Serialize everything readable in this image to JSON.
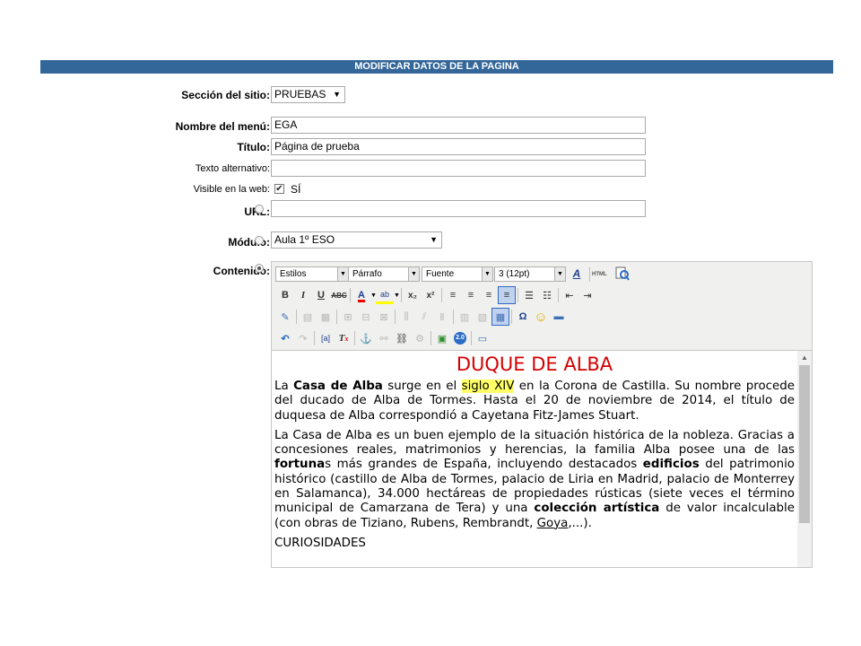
{
  "banner": {
    "title": "MODIFICAR DATOS DE LA PAGINA",
    "color": "#336699"
  },
  "form": {
    "seccion": {
      "label": "Sección del sitio:",
      "value": "PRUEBAS"
    },
    "nombre_menu": {
      "label": "Nombre del menú:",
      "value": "EGA"
    },
    "titulo": {
      "label": "Título:",
      "value": "Página de prueba"
    },
    "texto_alternativo": {
      "label": "Texto alternativo:",
      "value": ""
    },
    "visible": {
      "label": "Visible en la web:",
      "checked": true,
      "text": "SÍ"
    },
    "url": {
      "label": "URL:",
      "selected": false,
      "value": ""
    },
    "modulo": {
      "label": "Módulo:",
      "selected": false,
      "value": "Aula 1º ESO"
    },
    "contenido": {
      "label": "Contenido:",
      "selected": true
    }
  },
  "editor": {
    "toolbar": {
      "style_select": "Estilos",
      "format_select": "Párrafo",
      "font_select": "Fuente",
      "size_select": "3 (12pt)",
      "html_button": "HTML"
    },
    "content": {
      "heading": "DUQUE DE ALBA",
      "p1": {
        "t1": "La ",
        "b1": "Casa de Alba",
        "t2": " surge en el ",
        "hl": "siglo XIV",
        "t3": " en la Corona de Castilla. Su nombre procede del ducado de Alba de Tormes. Hasta el 20 de noviembre de 2014, el título de duquesa de Alba correspondió a Cayetana Fitz-James Stuart."
      },
      "p2": {
        "t1": "La Casa de Alba es un buen ejemplo de la situación histórica de la nobleza. Gracias a concesiones reales, matrimonios y herencias, la familia Alba posee una de las ",
        "b1": "fortuna",
        "t2": "s más grandes de España, incluyendo destacados ",
        "b2": "edificios",
        "t3": " del patrimonio histórico (castillo de Alba de Tormes, palacio de Liria en Madrid, palacio de Monterrey en Salamanca), 34.000 hectáreas de propiedades rústicas (siete veces el término municipal de Camarzana de Tera) y una ",
        "b3": "colección artística",
        "t4": " de valor incalculable (con obras de Tiziano, Rubens, Rembrandt, ",
        "u1": "Goya",
        "t5": ",...)."
      },
      "p3": "CURIOSIDADES"
    }
  }
}
